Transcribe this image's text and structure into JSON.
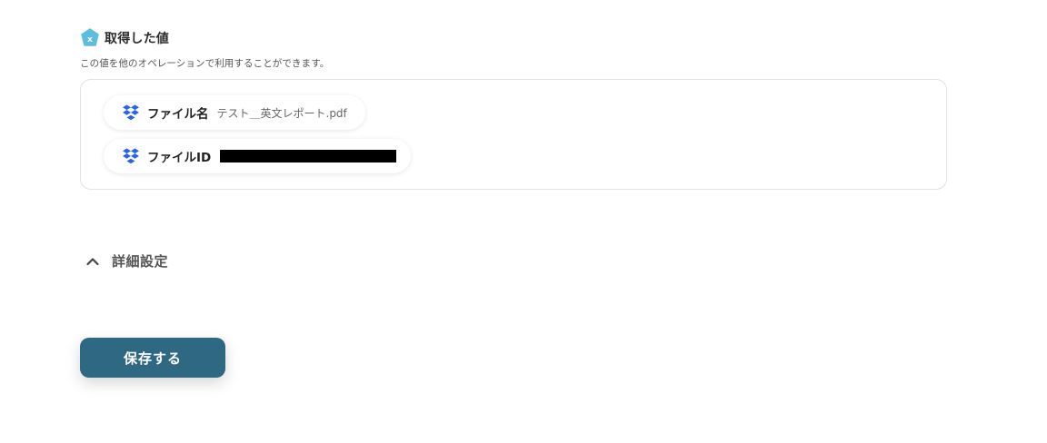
{
  "section": {
    "title": "取得した値",
    "description": "この値を他のオペレーションで利用することができます。",
    "icon": "x-badge-icon",
    "icon_color": "#5bbde0"
  },
  "values": [
    {
      "label": "ファイル名",
      "value": "テスト＿英文レポート.pdf",
      "icon": "dropbox-icon"
    },
    {
      "label": "ファイルID",
      "value": "",
      "redacted": true,
      "icon": "dropbox-icon"
    }
  ],
  "advanced": {
    "label": "詳細設定",
    "expanded": true,
    "icon": "chevron-up-icon"
  },
  "save_button": {
    "label": "保存する"
  },
  "colors": {
    "accent": "#2f6882",
    "dropbox": "#2a62e8"
  }
}
